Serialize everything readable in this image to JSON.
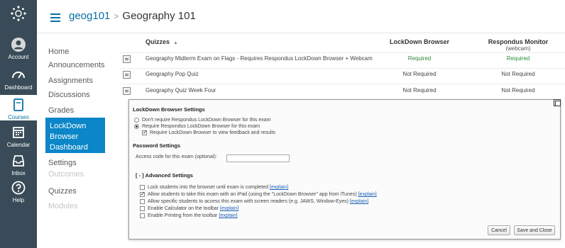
{
  "global_nav": {
    "items": [
      {
        "name": "account",
        "label": "Account"
      },
      {
        "name": "dashboard",
        "label": "Dashboard"
      },
      {
        "name": "courses",
        "label": "Courses"
      },
      {
        "name": "calendar",
        "label": "Calendar"
      },
      {
        "name": "inbox",
        "label": "Inbox"
      },
      {
        "name": "help",
        "label": "Help"
      }
    ]
  },
  "breadcrumb": {
    "course_code": "geog101",
    "separator": ">",
    "page": "Geography 101"
  },
  "course_nav": {
    "items": [
      {
        "label": "Home",
        "state": "normal"
      },
      {
        "label": "Announcements",
        "state": "normal"
      },
      {
        "label": "Assignments",
        "state": "normal"
      },
      {
        "label": "Discussions",
        "state": "normal"
      },
      {
        "label": "Grades",
        "state": "normal"
      },
      {
        "label": "LockDown Browser Dashboard",
        "state": "selected"
      },
      {
        "label": "Settings",
        "state": "normal"
      },
      {
        "label": "Outcomes",
        "state": "disabled"
      },
      {
        "label": "Quizzes",
        "state": "normal"
      },
      {
        "label": "Modules",
        "state": "disabled"
      }
    ]
  },
  "quizzes_table": {
    "headers": {
      "quizzes": "Quizzes",
      "sort_indicator": "▲",
      "lockdown": "LockDown Browser",
      "monitor": "Respondus Monitor",
      "monitor_sub": "(webcam)"
    },
    "rows": [
      {
        "name": "Geography Midterm Exam on Flags - Requires Respondus LockDown Browser + Webcam",
        "lockdown": "Required",
        "monitor": "Required"
      },
      {
        "name": "Geography Pop Quiz",
        "lockdown": "Not Required",
        "monitor": "Not Required"
      },
      {
        "name": "Geography Quiz Week Four",
        "lockdown": "Not Required",
        "monitor": "Not Required"
      }
    ]
  },
  "settings_panel": {
    "lockdown_heading": "LockDown Browser Settings",
    "opt_dont_require": "Don't require Respondus LockDown Browser for this exam",
    "opt_require": "Require Respondus LockDown Browser for this exam",
    "opt_feedback": "Require LockDown Browser to view feedback and results",
    "password_heading": "Password Settings",
    "access_code_label": "Access code for this exam (optional):",
    "access_code_value": "",
    "advanced_heading": "[ - ] Advanced Settings",
    "explain_label": "[explain]",
    "advanced_options": [
      {
        "label": "Lock students into the browser until exam is completed",
        "checked": false
      },
      {
        "label": "Allow students to take this exam with an iPad (using the \"LockDown Browser\" app from iTunes)",
        "checked": true
      },
      {
        "label": "Allow specific students to access this exam with screen readers (e.g. JAWS, Window-Eyes)",
        "checked": false
      },
      {
        "label": "Enable Calculator on the toolbar",
        "checked": false
      },
      {
        "label": "Enable Printing from the toolbar",
        "checked": false
      }
    ],
    "cancel_label": "Cancel",
    "save_label": "Save and Close"
  },
  "colors": {
    "global_nav_bg": "#394b58",
    "link_blue": "#0770a3",
    "selected_bg": "#0b86c8",
    "required_green": "#2d8c3c"
  }
}
